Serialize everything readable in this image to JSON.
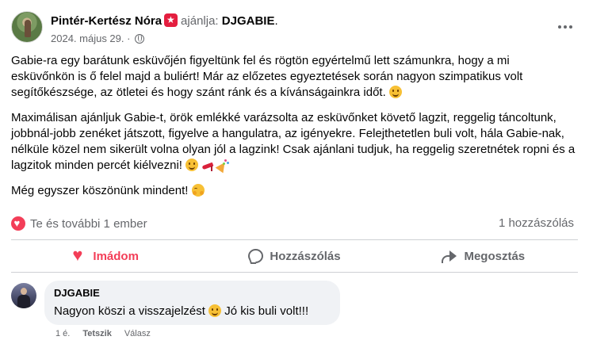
{
  "post": {
    "author": "Pintér-Kertész Nóra",
    "recommends_label": "ajánlja:",
    "recommended_page": "DJGABIE",
    "period": ".",
    "date": "2024. május 29.",
    "separator": "·",
    "paragraphs": {
      "p1": "Gabie-ra egy barátunk esküvőjén figyeltünk fel és rögtön egyértelmű lett számunkra, hogy a mi esküvőnkön is ő felel majd a buliért! Már az előzetes egyeztetések során nagyon szimpatikus volt segítőkészsége, az ötletei és hogy szánt ránk és a kívánságainkra időt.",
      "p2": "Maximálisan ajánljuk Gabie-t, örök emlékké varázsolta az esküvőnket követő lagzit, reggelig táncoltunk, jobbnál-jobb zenéket játszott, figyelve a hangulatra, az igényekre. Felejthetetlen buli volt, hála Gabie-nak, nélküle közel nem sikerült volna olyan jól a lagzink! Csak ajánlani tudjuk, ha reggelig szeretnétek ropni és a lagzitok minden percét kiélvezni!",
      "p3": "Még egyszer köszönünk mindent!"
    }
  },
  "summary": {
    "reactions": "Te és további 1 ember",
    "comments": "1 hozzászólás"
  },
  "actions": {
    "love": "Imádom",
    "comment": "Hozzászólás",
    "share": "Megosztás"
  },
  "comment": {
    "author": "DJGABIE",
    "text": "Nagyon köszi a visszajelzést",
    "text_suffix": "Jó kis buli volt!!!",
    "time": "1 é.",
    "like": "Tetszik",
    "reply": "Válasz"
  },
  "colors": {
    "love": "#f33e58",
    "secondary_text": "#65676b",
    "bubble": "#f0f2f5",
    "recommend_badge": "#e41e3f"
  },
  "icons": [
    "recommend-badge-icon",
    "globe-icon",
    "more-options-icon",
    "smile-emoji-icon",
    "high-heel-emoji-icon",
    "party-popper-emoji-icon",
    "hugging-face-emoji-icon",
    "love-reaction-icon",
    "heart-icon",
    "comment-icon",
    "share-icon"
  ]
}
